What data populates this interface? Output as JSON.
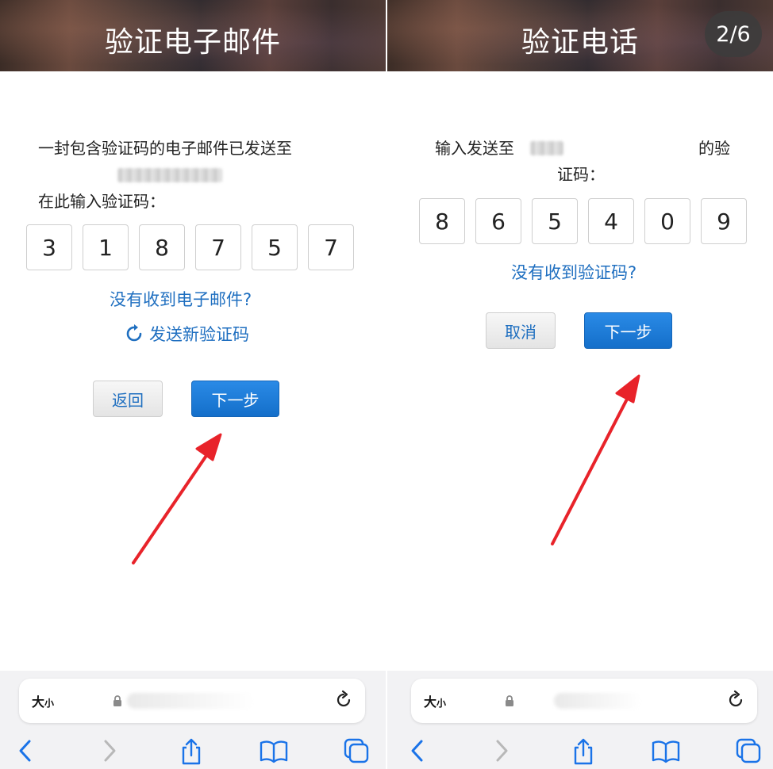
{
  "left": {
    "header_title": "验证电子邮件",
    "message": "一封包含验证码的电子邮件已发送至",
    "prompt": "在此输入验证码：",
    "code": [
      "3",
      "1",
      "8",
      "7",
      "5",
      "7"
    ],
    "no_email_link": "没有收到电子邮件?",
    "resend_label": "发送新验证码",
    "back_button": "返回",
    "next_button": "下一步"
  },
  "right": {
    "header_title": "验证电话",
    "page_indicator": "2/6",
    "message_part1": "输入发送至",
    "message_part2": "的验",
    "message_part3": "证码：",
    "code": [
      "8",
      "6",
      "5",
      "4",
      "0",
      "9"
    ],
    "no_code_link": "没有收到验证码?",
    "cancel_button": "取消",
    "next_button": "下一步"
  },
  "browser": {
    "text_size_big": "大",
    "text_size_small": "小"
  },
  "colors": {
    "link_blue": "#1f6fc0",
    "primary_button": "#1a7ad8",
    "annotation_arrow": "#e8232a"
  },
  "icons": {
    "lock": "lock-icon",
    "reload": "reload-icon",
    "back": "chevron-left-icon",
    "forward": "chevron-right-icon",
    "share": "share-icon",
    "bookmarks": "book-icon",
    "tabs": "tabs-icon",
    "resend": "refresh-icon"
  }
}
